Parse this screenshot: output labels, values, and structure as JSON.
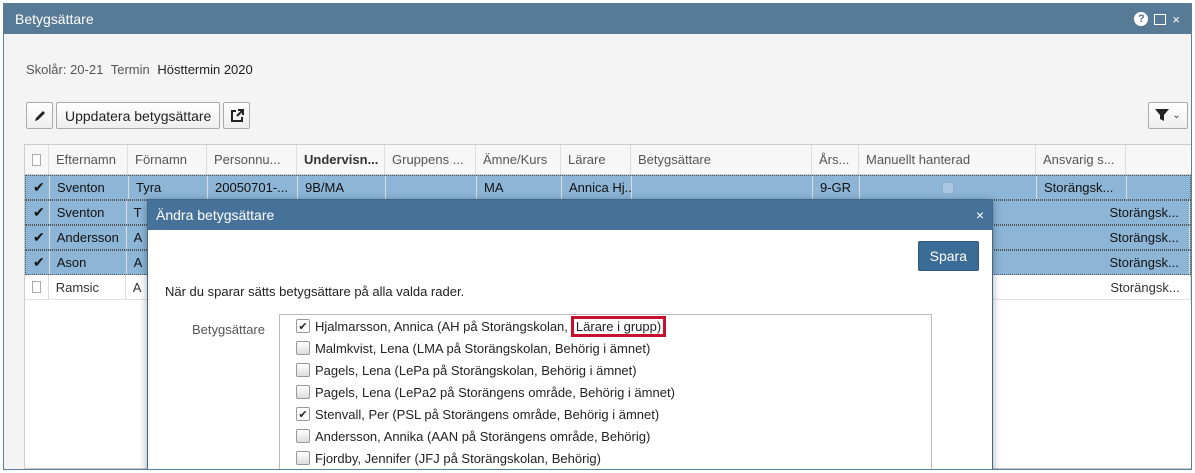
{
  "window": {
    "title": "Betygsättare"
  },
  "meta": {
    "year_label": "Skolår: 20-21",
    "term_label": "Termin",
    "term_value": "Hösttermin 2020"
  },
  "toolbar": {
    "update_label": "Uppdatera betygsättare"
  },
  "grid": {
    "headers": [
      "Efternamn",
      "Förnamn",
      "Personnu...",
      "Undervisn...",
      "Gruppens ...",
      "Ämne/Kurs",
      "Lärare",
      "Betygsättare",
      "Års...",
      "Manuellt hanterad",
      "Ansvarig s..."
    ],
    "rows": [
      {
        "selected": true,
        "cells": [
          "Sventon",
          "Tyra",
          "20050701-...",
          "9B/MA",
          "",
          "MA",
          "Annica Hj...",
          "",
          "9-GR",
          "",
          "Storängsk..."
        ]
      },
      {
        "selected": true,
        "cells": [
          "Sventon",
          "T",
          "",
          "",
          "",
          "",
          "",
          "",
          "",
          "",
          "Storängsk..."
        ]
      },
      {
        "selected": true,
        "cells": [
          "Andersson",
          "A",
          "",
          "",
          "",
          "",
          "",
          "",
          "",
          "",
          "Storängsk..."
        ]
      },
      {
        "selected": true,
        "cells": [
          "Ason",
          "A",
          "",
          "",
          "",
          "",
          "",
          "",
          "",
          "",
          "Storängsk..."
        ]
      },
      {
        "selected": false,
        "cells": [
          "Ramsic",
          "A",
          "",
          "",
          "",
          "",
          "",
          "",
          "",
          "",
          "Storängsk..."
        ]
      }
    ]
  },
  "dialog": {
    "title": "Ändra betygsättare",
    "save_label": "Spara",
    "notice": "När du sparar sätts betygsättare på alla valda rader.",
    "field_label": "Betygsättare",
    "options": [
      {
        "checked": true,
        "text": "Hjalmarsson, Annica (AH på Storängskolan,",
        "highlight": "Lärare i grupp)"
      },
      {
        "checked": false,
        "text": "Malmkvist, Lena (LMA på Storängskolan, Behörig i ämnet)",
        "highlight": ""
      },
      {
        "checked": false,
        "text": "Pagels, Lena (LePa på Storängskolan, Behörig i ämnet)",
        "highlight": ""
      },
      {
        "checked": false,
        "text": "Pagels, Lena (LePa2 på Storängens område, Behörig i ämnet)",
        "highlight": ""
      },
      {
        "checked": true,
        "text": "Stenvall, Per (PSL på Storängens område, Behörig i ämnet)",
        "highlight": ""
      },
      {
        "checked": false,
        "text": "Andersson, Annika (AAN på Storängens område, Behörig)",
        "highlight": ""
      },
      {
        "checked": false,
        "text": "Fjordby, Jennifer (JFJ på Storängskolan, Behörig)",
        "highlight": ""
      }
    ]
  }
}
